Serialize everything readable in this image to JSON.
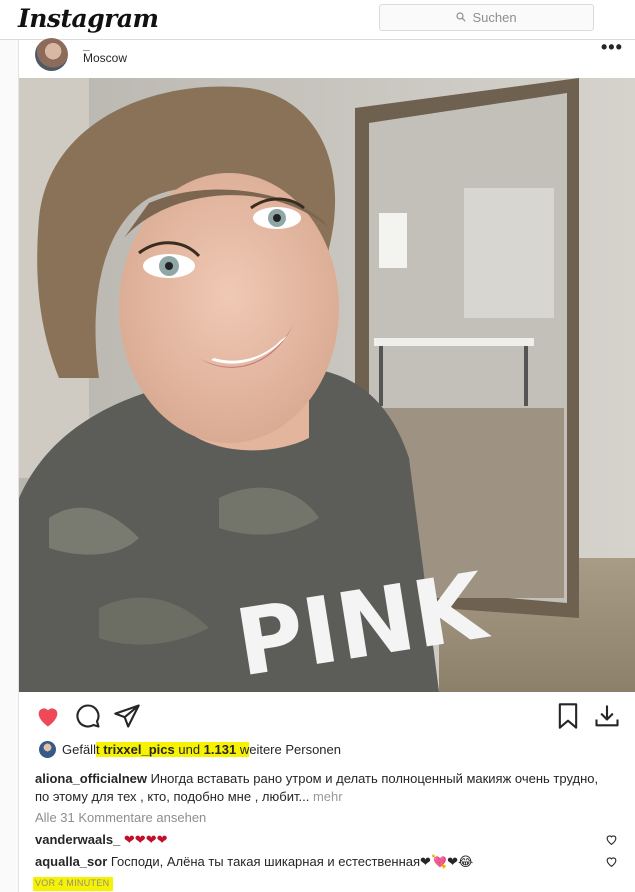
{
  "header": {
    "logo": "Instagram",
    "search_placeholder": "Suchen"
  },
  "post": {
    "username_partial": "_",
    "location": "Moscow",
    "more_label": "•••",
    "photo_text": "PINK",
    "likes": {
      "prefix": "Gefäll",
      "highlight_t": "t ",
      "user": "trixxel_pics",
      "und": " und ",
      "count": "1.131",
      "weitere_w": " w",
      "rest": "eitere Personen"
    },
    "caption": {
      "user": "aliona_officialnew",
      "text": "Иногда вставать рано утром и делать полноценный макияж очень трудно, по этому для тех , кто, подобно мне , любит...",
      "more": "mehr"
    },
    "view_all": "Alle 31 Kommentare ansehen",
    "comments": [
      {
        "user": "vanderwaals_",
        "text": "❤❤❤❤"
      },
      {
        "user": "aqualla_sor",
        "text": "Господи, Алёна ты такая шикарная и естественная❤💘❤😂"
      }
    ],
    "timestamp": "VOR 4 MINUTEN"
  },
  "colors": {
    "heart_red": "#ed4956",
    "highlight": "#f7f200",
    "border": "#dbdbdb"
  },
  "icons": [
    "search-icon",
    "more-icon",
    "heart-icon",
    "comment-icon",
    "share-icon",
    "bookmark-icon",
    "download-icon",
    "comment-like-icon"
  ]
}
